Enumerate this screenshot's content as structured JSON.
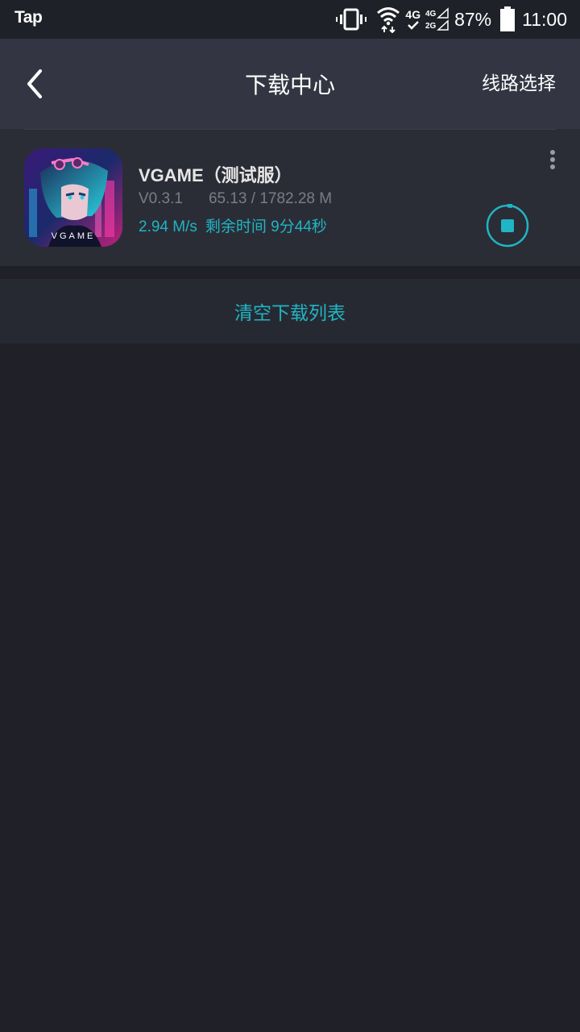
{
  "status_bar": {
    "app_label": "Tap",
    "network_label": "4G",
    "battery_percent": "87%",
    "time": "11:00"
  },
  "header": {
    "title": "下载中心",
    "route_button": "线路选择"
  },
  "download": {
    "name": "VGAME（测试服）",
    "version": "V0.3.1",
    "size_progress": "65.13 / 1782.28 M",
    "speed": "2.94 M/s",
    "remaining": "剩余时间 9分44秒",
    "progress_fraction": 0.0365,
    "icon_text": "VGAME"
  },
  "footer": {
    "clear_button": "清空下载列表"
  },
  "colors": {
    "accent": "#20b5c4",
    "appbar": "#333642",
    "background": "#1f2028"
  }
}
